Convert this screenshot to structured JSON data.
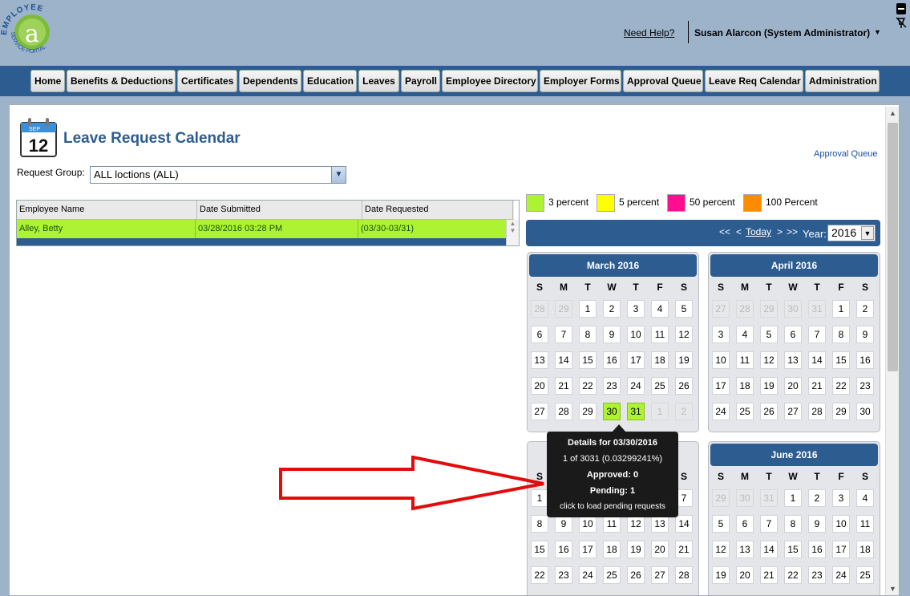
{
  "header": {
    "logo_text": "EMPLOYEE SERVICE PORTAL",
    "logo_letter": "a",
    "help_link": "Need Help?",
    "user": "Susan Alarcon (System Administrator)"
  },
  "nav": {
    "items": [
      "Home",
      "Benefits & Deductions",
      "Certificates",
      "Dependents",
      "Education",
      "Leaves",
      "Payroll",
      "Employee Directory",
      "Employer Forms",
      "Approval Queue",
      "Leave Req Calendar",
      "Administration"
    ]
  },
  "page": {
    "icon_month": "SEP",
    "icon_day": "12",
    "title": "Leave Request Calendar",
    "approval_link": "Approval Queue",
    "request_group_label": "Request Group:",
    "request_group_value": "ALL loctions (ALL)"
  },
  "grid": {
    "columns": [
      "Employee Name",
      "Date Submitted",
      "Date Requested"
    ],
    "rows": [
      [
        "Alley, Betty",
        "03/28/2016 03:28 PM",
        "(03/30-03/31)"
      ]
    ]
  },
  "legend": [
    {
      "label": "3 percent",
      "color": "#aef234"
    },
    {
      "label": "5 percent",
      "color": "#ffff00"
    },
    {
      "label": "50 percent",
      "color": "#ff0f8f"
    },
    {
      "label": "100 Percent",
      "color": "#ff8c00"
    }
  ],
  "calendar_toolbar": {
    "prev_year": "<<",
    "prev": "<",
    "today": "Today",
    "next": ">",
    "next_year": ">>",
    "year_label": "Year:",
    "year_value": "2016"
  },
  "weekdays": [
    "S",
    "M",
    "T",
    "W",
    "T",
    "F",
    "S"
  ],
  "months": [
    {
      "title": "March 2016",
      "weeks": [
        [
          "28",
          "29",
          "1",
          "2",
          "3",
          "4",
          "5"
        ],
        [
          "6",
          "7",
          "8",
          "9",
          "10",
          "11",
          "12"
        ],
        [
          "13",
          "14",
          "15",
          "16",
          "17",
          "18",
          "19"
        ],
        [
          "20",
          "21",
          "22",
          "23",
          "24",
          "25",
          "26"
        ],
        [
          "27",
          "28",
          "29",
          "30",
          "31",
          "1",
          "2"
        ]
      ],
      "other": [
        [
          0,
          0
        ],
        [
          0,
          1
        ],
        [
          4,
          5
        ],
        [
          4,
          6
        ]
      ],
      "highlight": [
        [
          4,
          3
        ],
        [
          4,
          4
        ]
      ]
    },
    {
      "title": "April 2016",
      "weeks": [
        [
          "27",
          "28",
          "29",
          "30",
          "31",
          "1",
          "2"
        ],
        [
          "3",
          "4",
          "5",
          "6",
          "7",
          "8",
          "9"
        ],
        [
          "10",
          "11",
          "12",
          "13",
          "14",
          "15",
          "16"
        ],
        [
          "17",
          "18",
          "19",
          "20",
          "21",
          "22",
          "23"
        ],
        [
          "24",
          "25",
          "26",
          "27",
          "28",
          "29",
          "30"
        ]
      ],
      "other": [
        [
          0,
          0
        ],
        [
          0,
          1
        ],
        [
          0,
          2
        ],
        [
          0,
          3
        ],
        [
          0,
          4
        ]
      ],
      "highlight": []
    },
    {
      "title": "",
      "weeks": [
        [
          "1",
          "2",
          "3",
          "4",
          "5",
          "6",
          "7"
        ],
        [
          "8",
          "9",
          "10",
          "11",
          "12",
          "13",
          "14"
        ],
        [
          "15",
          "16",
          "17",
          "18",
          "19",
          "20",
          "21"
        ],
        [
          "22",
          "23",
          "24",
          "25",
          "26",
          "27",
          "28"
        ]
      ],
      "other": [],
      "highlight": []
    },
    {
      "title": "June 2016",
      "weeks": [
        [
          "29",
          "30",
          "31",
          "1",
          "2",
          "3",
          "4"
        ],
        [
          "5",
          "6",
          "7",
          "8",
          "9",
          "10",
          "11"
        ],
        [
          "12",
          "13",
          "14",
          "15",
          "16",
          "17",
          "18"
        ],
        [
          "19",
          "20",
          "21",
          "22",
          "23",
          "24",
          "25"
        ]
      ],
      "other": [
        [
          0,
          0
        ],
        [
          0,
          1
        ],
        [
          0,
          2
        ]
      ],
      "highlight": []
    }
  ],
  "tooltip": {
    "title": "Details for 03/30/2016",
    "ratio": "1 of 3031 (0.03299241%)",
    "approved": "Approved: 0",
    "pending": "Pending: 1",
    "hint": "click to load pending requests"
  },
  "colors": {
    "nav_blue": "#2d5c91",
    "header_bg": "#9db3c9",
    "highlight_green": "#aef234",
    "arrow_red": "#e30b0b"
  }
}
